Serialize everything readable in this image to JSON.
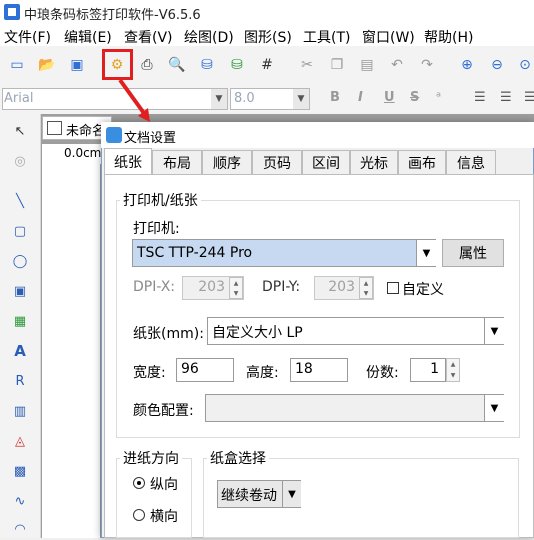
{
  "app": {
    "title": "中琅条码标签打印软件-V6.5.6"
  },
  "menu": [
    "文件(F)",
    "编辑(E)",
    "查看(V)",
    "绘图(D)",
    "图形(S)",
    "工具(T)",
    "窗口(W)",
    "帮助(H)"
  ],
  "toolbar_icons": [
    "new-icon",
    "open-icon",
    "save-icon",
    "document-settings-icon",
    "print-icon",
    "print-preview-icon",
    "database-icon",
    "database-settings-icon",
    "grid-icon",
    "cut-icon",
    "copy-icon",
    "paste-icon",
    "undo-icon",
    "redo-icon",
    "zoom-in-icon",
    "zoom-out-icon",
    "zoom-icon"
  ],
  "format": {
    "font": "Arial",
    "size": "8.0",
    "bold": "B",
    "italic": "I",
    "underline": "U",
    "strike": "S"
  },
  "left_tools": [
    "select-icon",
    "hand-icon",
    "line-icon",
    "rect-icon",
    "ellipse-icon",
    "image-icon",
    "picture-icon",
    "text-icon",
    "rich-text-icon",
    "barcode-icon",
    "shape-icon",
    "qr-icon",
    "curve-icon",
    "arc-icon"
  ],
  "document": {
    "tab_label": "未命名",
    "ruler_label": "0.0cm"
  },
  "dialog": {
    "title": "文档设置",
    "tabs": [
      "纸张",
      "布局",
      "顺序",
      "页码",
      "区间",
      "光标",
      "画布",
      "信息"
    ],
    "active_tab": "纸张",
    "printer_group": "打印机/纸张",
    "printer_label": "打印机:",
    "printer_value": "TSC TTP-244 Pro",
    "properties_button": "属性",
    "dpi_x_label": "DPI-X:",
    "dpi_x_value": "203",
    "dpi_y_label": "DPI-Y:",
    "dpi_y_value": "203",
    "custom_label": "自定义",
    "paper_label": "纸张(mm):",
    "paper_value": "自定义大小 LP",
    "width_label": "宽度:",
    "width_value": "96",
    "height_label": "高度:",
    "height_value": "18",
    "copies_label": "份数:",
    "copies_value": "1",
    "color_label": "颜色配置:",
    "color_value": "",
    "feed_group": "进纸方向",
    "portrait_label": "纵向",
    "landscape_label": "横向",
    "tray_group": "纸盒选择",
    "tray_value": "继续卷动"
  },
  "colors": {
    "highlight": "#e02020",
    "accent": "#2f6fd6"
  }
}
